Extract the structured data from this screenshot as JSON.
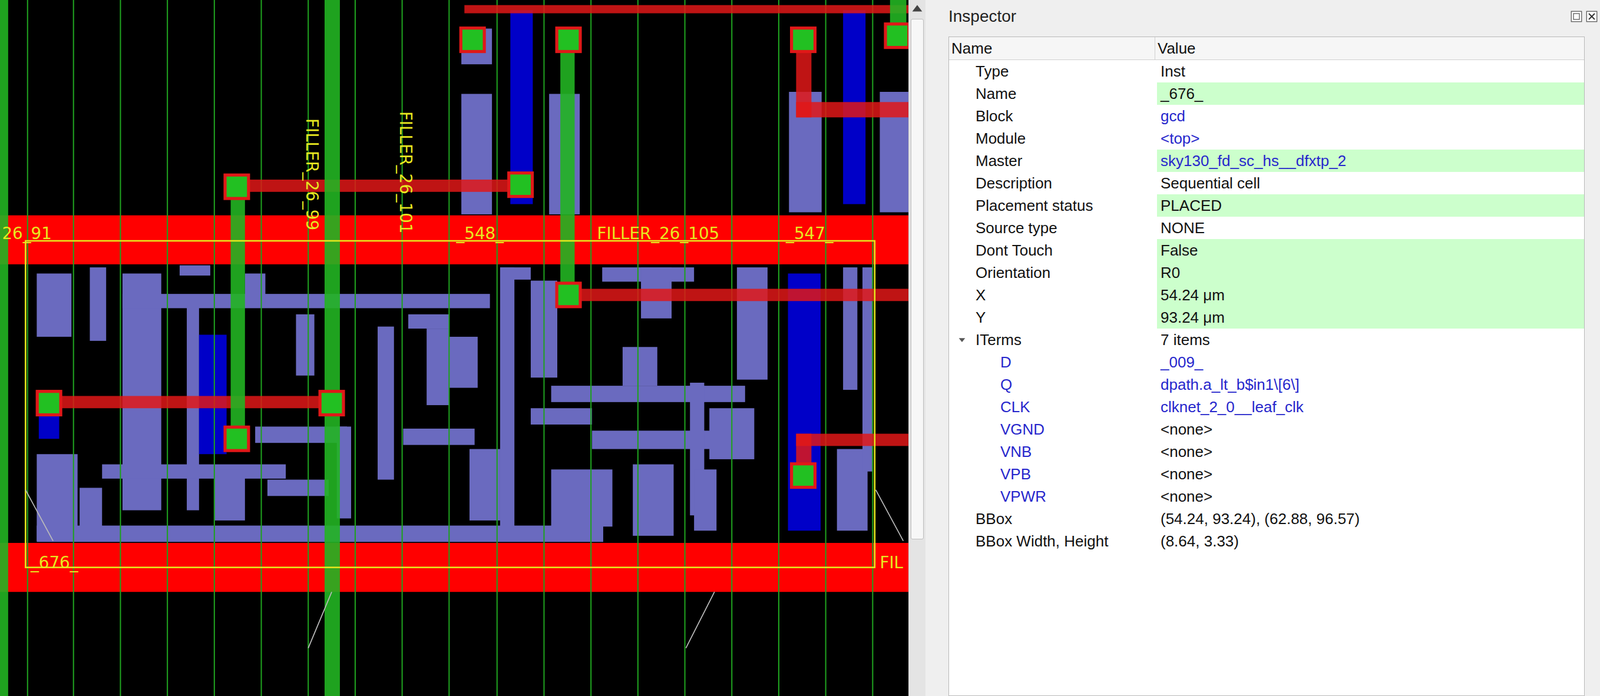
{
  "canvas": {
    "labels": [
      {
        "text": "26_91",
        "kind": "horizontal"
      },
      {
        "text": "FILLER_26_99",
        "kind": "vertical"
      },
      {
        "text": "FILLER_26_101",
        "kind": "vertical"
      },
      {
        "text": "_548_",
        "kind": "horizontal"
      },
      {
        "text": "FILLER_26_105",
        "kind": "horizontal"
      },
      {
        "text": "_547_",
        "kind": "horizontal"
      },
      {
        "text": "_676_",
        "kind": "horizontal"
      },
      {
        "text": "FIL",
        "kind": "horizontal"
      }
    ]
  },
  "scrollbar": {
    "level": 0.77
  },
  "inspector": {
    "title": "Inspector",
    "columns": [
      "Name",
      "Value"
    ],
    "rows": [
      {
        "name": "Type",
        "value": "Inst",
        "kind": "property",
        "editable": false,
        "name_link": false,
        "value_link": false
      },
      {
        "name": "Name",
        "value": "_676_",
        "kind": "property",
        "editable": true,
        "name_link": false,
        "value_link": false
      },
      {
        "name": "Block",
        "value": "gcd",
        "kind": "property",
        "editable": false,
        "name_link": false,
        "value_link": true
      },
      {
        "name": "Module",
        "value": "<top>",
        "kind": "property",
        "editable": false,
        "name_link": false,
        "value_link": true
      },
      {
        "name": "Master",
        "value": "sky130_fd_sc_hs__dfxtp_2",
        "kind": "property",
        "editable": true,
        "name_link": false,
        "value_link": true
      },
      {
        "name": "Description",
        "value": "Sequential cell",
        "kind": "property",
        "editable": false,
        "name_link": false,
        "value_link": false
      },
      {
        "name": "Placement status",
        "value": "PLACED",
        "kind": "property",
        "editable": true,
        "name_link": false,
        "value_link": false
      },
      {
        "name": "Source type",
        "value": "NONE",
        "kind": "property",
        "editable": false,
        "name_link": false,
        "value_link": false
      },
      {
        "name": "Dont Touch",
        "value": "False",
        "kind": "property",
        "editable": true,
        "name_link": false,
        "value_link": false
      },
      {
        "name": "Orientation",
        "value": "R0",
        "kind": "property",
        "editable": true,
        "name_link": false,
        "value_link": false
      },
      {
        "name": "X",
        "value": "54.24 μm",
        "kind": "property",
        "editable": true,
        "name_link": false,
        "value_link": false
      },
      {
        "name": "Y",
        "value": "93.24 μm",
        "kind": "property",
        "editable": true,
        "name_link": false,
        "value_link": false
      },
      {
        "name": "ITerms",
        "value": "7 items",
        "kind": "group",
        "expanded": true,
        "editable": false,
        "name_link": false,
        "value_link": false
      },
      {
        "name": "D",
        "value": "_009_",
        "kind": "child",
        "editable": false,
        "name_link": true,
        "value_link": true
      },
      {
        "name": "Q",
        "value": "dpath.a_lt_b$in1\\[6\\]",
        "kind": "child",
        "editable": false,
        "name_link": true,
        "value_link": true
      },
      {
        "name": "CLK",
        "value": "clknet_2_0__leaf_clk",
        "kind": "child",
        "editable": false,
        "name_link": true,
        "value_link": true
      },
      {
        "name": "VGND",
        "value": "<none>",
        "kind": "child",
        "editable": false,
        "name_link": true,
        "value_link": false
      },
      {
        "name": "VNB",
        "value": "<none>",
        "kind": "child",
        "editable": false,
        "name_link": true,
        "value_link": false
      },
      {
        "name": "VPB",
        "value": "<none>",
        "kind": "child",
        "editable": false,
        "name_link": true,
        "value_link": false
      },
      {
        "name": "VPWR",
        "value": "<none>",
        "kind": "child",
        "editable": false,
        "name_link": true,
        "value_link": false
      },
      {
        "name": "BBox",
        "value": "(54.24, 93.24), (62.88, 96.57)",
        "kind": "property",
        "editable": false,
        "name_link": false,
        "value_link": false
      },
      {
        "name": "BBox Width, Height",
        "value": "(8.64, 3.33)",
        "kind": "property",
        "editable": false,
        "name_link": false,
        "value_link": false
      }
    ]
  }
}
